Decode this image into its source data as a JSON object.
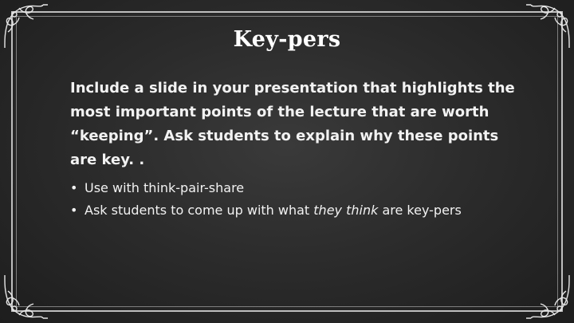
{
  "slide": {
    "title": "Key-pers",
    "lead": "Include a slide in your presentation that highlights the most important points of the lecture that are worth “keeping”.  Ask students to explain why these points are key. .",
    "bullets": [
      {
        "text": "Use with think-pair-share"
      },
      {
        "prefix": "Ask students to come up with what ",
        "emphasis": "they think",
        "suffix": " are key-pers"
      }
    ],
    "bullet_glyph": "•"
  },
  "colors": {
    "background": "#2c2c2c",
    "text": "#f2f2f2",
    "frame": "#d9d9d9"
  },
  "icons": {
    "corner": "ornamental-scroll-corner"
  }
}
